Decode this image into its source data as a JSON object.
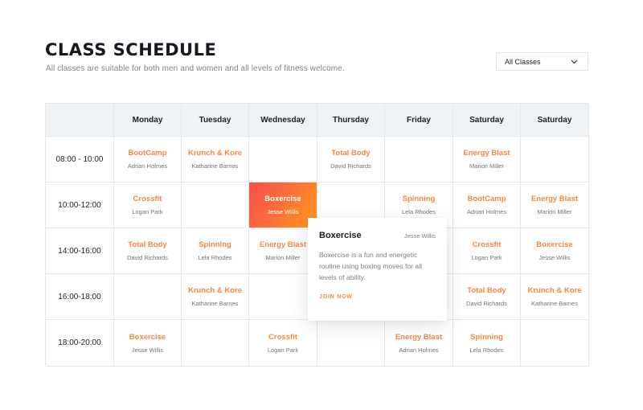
{
  "header": {
    "title": "CLASS SCHEDULE",
    "subtitle": "All classes are suitable for both men and women and all levels of fitness welcome."
  },
  "filter": {
    "selected": "All Classes",
    "icon": "chevron-down-icon"
  },
  "accent_color": "#f7863f",
  "active_gradient": [
    "#f7504a",
    "#ff9a1d"
  ],
  "days": [
    "Monday",
    "Tuesday",
    "Wednesday",
    "Thursday",
    "Friday",
    "Saturday",
    "Saturday"
  ],
  "rows": [
    {
      "time": "08:00 - 10:00",
      "cells": [
        {
          "name": "BootCamp",
          "trainer": "Adrian Holmes"
        },
        {
          "name": "Krunch & Kore",
          "trainer": "Katharine Barnes"
        },
        null,
        {
          "name": "Total Body",
          "trainer": "David Richards"
        },
        null,
        {
          "name": "Energy Blast",
          "trainer": "Marion Miller"
        },
        null
      ]
    },
    {
      "time": "10:00-12:00",
      "cells": [
        {
          "name": "Crossfit",
          "trainer": "Logan Park"
        },
        null,
        {
          "name": "Boxercise",
          "trainer": "Jesse Willis",
          "active": true
        },
        null,
        {
          "name": "Spinning",
          "trainer": "Lela Rhodes"
        },
        {
          "name": "BootCamp",
          "trainer": "Adrian Holmes"
        },
        {
          "name": "Energy Blast",
          "trainer": "Marion Miller"
        }
      ]
    },
    {
      "time": "14:00-16:00",
      "cells": [
        {
          "name": "Total Body",
          "trainer": "David Richards"
        },
        {
          "name": "Spinning",
          "trainer": "Lela Rhodes"
        },
        {
          "name": "Energy Blast",
          "trainer": "Marion Miller"
        },
        null,
        null,
        {
          "name": "Crossfit",
          "trainer": "Logan Park"
        },
        {
          "name": "Boxercise",
          "trainer": "Jesse Willis"
        }
      ]
    },
    {
      "time": "16:00-18:00",
      "cells": [
        null,
        {
          "name": "Krunch & Kore",
          "trainer": "Katharine Barnes"
        },
        null,
        null,
        null,
        {
          "name": "Total Body",
          "trainer": "David Richards"
        },
        {
          "name": "Krunch & Kore",
          "trainer": "Katharine Barnes"
        }
      ]
    },
    {
      "time": "18:00-20:00",
      "cells": [
        {
          "name": "Boxercise",
          "trainer": "Jesse Willis"
        },
        null,
        {
          "name": "Crossfit",
          "trainer": "Logan Park"
        },
        null,
        {
          "name": "Energy Blast",
          "trainer": "Adrian Holmes"
        },
        {
          "name": "Spinning",
          "trainer": "Lela Rhodes"
        },
        null
      ]
    }
  ],
  "popover": {
    "title": "Boxercise",
    "trainer": "Jesse Willis",
    "description": "Boxercise is a fun and energetic routine using boxing moves for all levels of ability.",
    "cta": "JOIN NOW"
  }
}
